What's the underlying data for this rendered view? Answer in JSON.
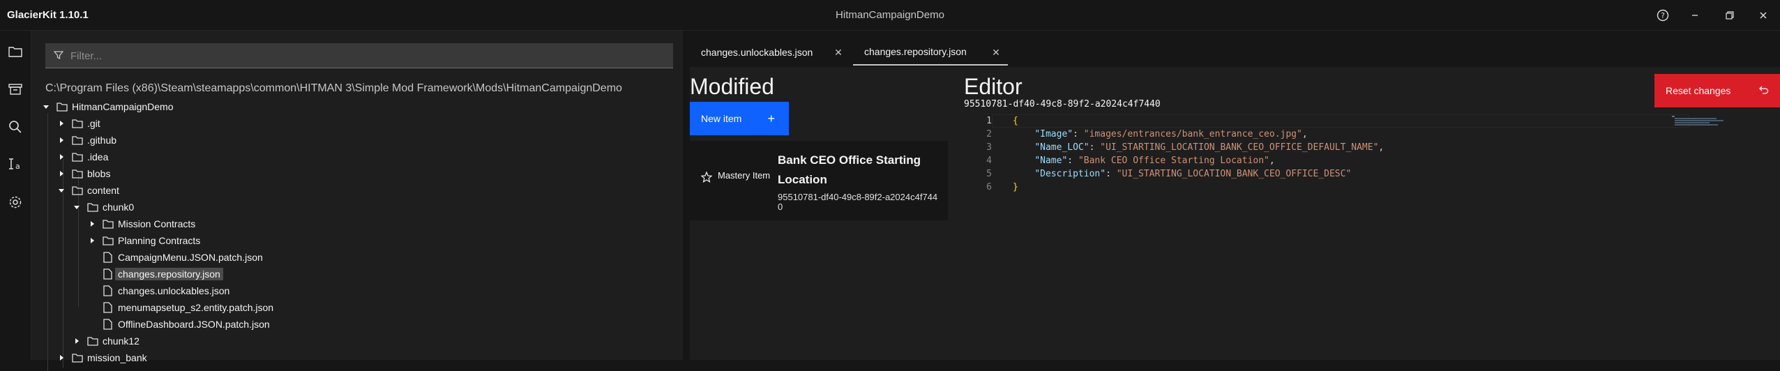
{
  "app": {
    "title": "GlacierKit 1.10.1",
    "window_title": "HitmanCampaignDemo"
  },
  "rail_icons": [
    "folder-icon",
    "archive-icon",
    "search-icon",
    "text-style-icon",
    "settings-icon"
  ],
  "explorer": {
    "filter_placeholder": "Filter...",
    "path": "C:\\Program Files (x86)\\Steam\\steamapps\\common\\HITMAN 3\\Simple Mod Framework\\Mods\\HitmanCampaignDemo",
    "tree": [
      {
        "label": "HitmanCampaignDemo",
        "kind": "folder",
        "expanded": true
      },
      {
        "label": ".git",
        "kind": "folder",
        "expanded": false
      },
      {
        "label": ".github",
        "kind": "folder",
        "expanded": false
      },
      {
        "label": ".idea",
        "kind": "folder",
        "expanded": false
      },
      {
        "label": "blobs",
        "kind": "folder",
        "expanded": false
      },
      {
        "label": "content",
        "kind": "folder",
        "expanded": true
      },
      {
        "label": "chunk0",
        "kind": "folder",
        "expanded": true
      },
      {
        "label": "Mission Contracts",
        "kind": "folder",
        "expanded": false
      },
      {
        "label": "Planning Contracts",
        "kind": "folder",
        "expanded": false
      },
      {
        "label": "CampaignMenu.JSON.patch.json",
        "kind": "file"
      },
      {
        "label": "changes.repository.json",
        "kind": "file",
        "selected": true
      },
      {
        "label": "changes.unlockables.json",
        "kind": "file"
      },
      {
        "label": "menumapsetup_s2.entity.patch.json",
        "kind": "file"
      },
      {
        "label": "OfflineDashboard.JSON.patch.json",
        "kind": "file"
      },
      {
        "label": "chunk12",
        "kind": "folder",
        "expanded": false
      },
      {
        "label": "mission_bank",
        "kind": "folder",
        "expanded": false
      }
    ]
  },
  "tabs": [
    {
      "label": "changes.unlockables.json",
      "active": false
    },
    {
      "label": "changes.repository.json",
      "active": true
    }
  ],
  "modified": {
    "heading": "Modified",
    "new_item_label": "New item",
    "item": {
      "type_label": "Mastery Item",
      "name": "Bank CEO Office Starting Location",
      "id": "95510781-df40-49c8-89f2-a2024c4f7440"
    }
  },
  "editor": {
    "heading": "Editor",
    "item_id": "95510781-df40-49c8-89f2-a2024c4f7440",
    "reset_label": "Reset changes",
    "line_numbers": [
      "1",
      "2",
      "3",
      "4",
      "5",
      "6"
    ],
    "json": [
      {
        "key": "Image",
        "value": "images/entrances/bank_entrance_ceo.jpg"
      },
      {
        "key": "Name_LOC",
        "value": "UI_STARTING_LOCATION_BANK_CEO_OFFICE_DEFAULT_NAME"
      },
      {
        "key": "Name",
        "value": "Bank CEO Office Starting Location"
      },
      {
        "key": "Description",
        "value": "UI_STARTING_LOCATION_BANK_CEO_OFFICE_DESC"
      }
    ]
  },
  "colors": {
    "accent_blue": "#0f62fe",
    "danger_red": "#da1e28",
    "selection_bg": "#4c4c4c"
  }
}
